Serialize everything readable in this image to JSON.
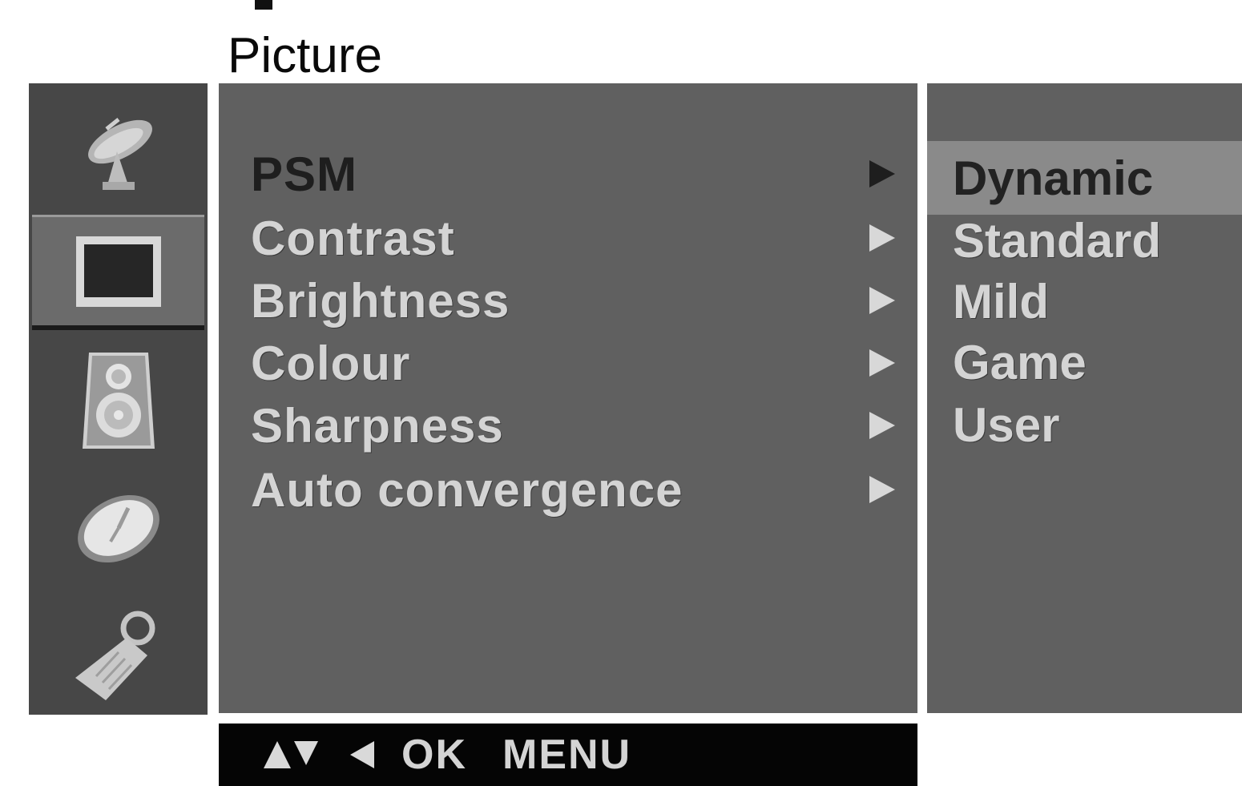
{
  "header": {
    "title": "Picture"
  },
  "sidebar": {
    "items": [
      {
        "icon": "satellite-dish-icon",
        "selected": false
      },
      {
        "icon": "picture-screen-icon",
        "selected": true
      },
      {
        "icon": "speaker-icon",
        "selected": false
      },
      {
        "icon": "clock-icon",
        "selected": false
      },
      {
        "icon": "key-tag-icon",
        "selected": false
      }
    ]
  },
  "menu": {
    "items": [
      {
        "label": "PSM",
        "active": true
      },
      {
        "label": "Contrast",
        "active": false
      },
      {
        "label": "Brightness",
        "active": false
      },
      {
        "label": "Colour",
        "active": false
      },
      {
        "label": "Sharpness",
        "active": false
      },
      {
        "label": "Auto convergence",
        "active": false
      }
    ]
  },
  "submenu": {
    "items": [
      {
        "label": "Dynamic",
        "highlighted": true
      },
      {
        "label": "Standard",
        "highlighted": false
      },
      {
        "label": "Mild",
        "highlighted": false
      },
      {
        "label": "Game",
        "highlighted": false
      },
      {
        "label": "User",
        "highlighted": false
      }
    ]
  },
  "hint_bar": {
    "ok_label": "OK",
    "menu_label": "MENU"
  },
  "colors": {
    "panel": "#606060",
    "sidebar": "#474747",
    "highlight": "#8a8a8a",
    "hint_bar": "#050505"
  }
}
